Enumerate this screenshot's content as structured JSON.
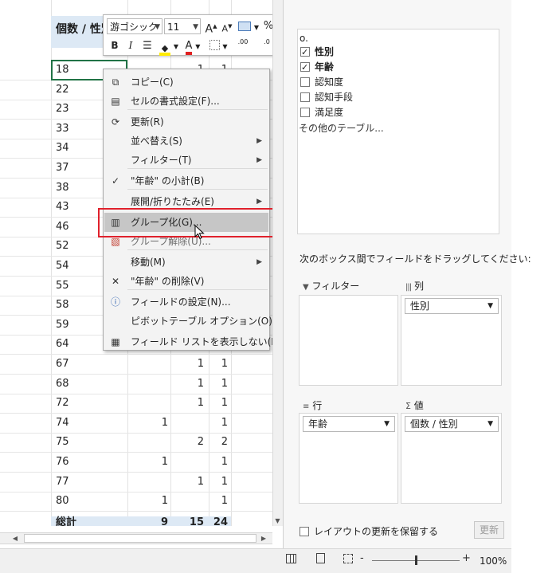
{
  "sheet": {
    "header_label": "個数 / 性別",
    "rows": [
      {
        "age": "18",
        "a": "",
        "b": "1",
        "t": "1"
      },
      {
        "age": "22",
        "a": "",
        "b": "",
        "t": ""
      },
      {
        "age": "23",
        "a": "",
        "b": "",
        "t": ""
      },
      {
        "age": "33",
        "a": "",
        "b": "",
        "t": ""
      },
      {
        "age": "34",
        "a": "",
        "b": "",
        "t": ""
      },
      {
        "age": "37",
        "a": "",
        "b": "",
        "t": ""
      },
      {
        "age": "38",
        "a": "",
        "b": "",
        "t": ""
      },
      {
        "age": "43",
        "a": "",
        "b": "",
        "t": ""
      },
      {
        "age": "46",
        "a": "",
        "b": "",
        "t": ""
      },
      {
        "age": "52",
        "a": "",
        "b": "",
        "t": ""
      },
      {
        "age": "54",
        "a": "",
        "b": "",
        "t": ""
      },
      {
        "age": "55",
        "a": "",
        "b": "",
        "t": ""
      },
      {
        "age": "58",
        "a": "",
        "b": "",
        "t": ""
      },
      {
        "age": "59",
        "a": "",
        "b": "",
        "t": ""
      },
      {
        "age": "64",
        "a": "",
        "b": "",
        "t": ""
      },
      {
        "age": "67",
        "a": "",
        "b": "1",
        "t": "1"
      },
      {
        "age": "68",
        "a": "",
        "b": "1",
        "t": "1"
      },
      {
        "age": "72",
        "a": "",
        "b": "1",
        "t": "1"
      },
      {
        "age": "74",
        "a": "1",
        "b": "",
        "t": "1"
      },
      {
        "age": "75",
        "a": "",
        "b": "2",
        "t": "2"
      },
      {
        "age": "76",
        "a": "1",
        "b": "",
        "t": "1"
      },
      {
        "age": "77",
        "a": "",
        "b": "1",
        "t": "1"
      },
      {
        "age": "80",
        "a": "1",
        "b": "",
        "t": "1"
      }
    ],
    "total": {
      "label": "総計",
      "a": "9",
      "b": "15",
      "t": "24"
    }
  },
  "toolbar": {
    "font_name": "游ゴシック",
    "font_size": "11",
    "increase_font": "A",
    "decrease_font": "A",
    "percent": "%",
    "comma": ",",
    "bold": "B",
    "italic": "I",
    "font_color_letter": "A",
    "decimal_increase": ".00",
    "decimal_decrease": ".0"
  },
  "context_menu": {
    "items": [
      {
        "label": "コピー(C)",
        "icon": "copy-icon"
      },
      {
        "label": "セルの書式設定(F)...",
        "icon": "format-cells-icon"
      },
      {
        "label": "更新(R)",
        "icon": "refresh-icon"
      },
      {
        "label": "並べ替え(S)",
        "icon": ""
      },
      {
        "label": "フィルター(T)",
        "icon": ""
      },
      {
        "label": "\"年齢\" の小計(B)",
        "icon": "check-icon"
      },
      {
        "label": "展開/折りたたみ(E)",
        "icon": ""
      },
      {
        "label": "グループ化(G)...",
        "icon": "group-icon"
      },
      {
        "label": "グループ解除(U)...",
        "icon": "ungroup-icon"
      },
      {
        "label": "移動(M)",
        "icon": ""
      },
      {
        "label": "\"年齢\" の削除(V)",
        "icon": "delete-x-icon"
      },
      {
        "label": "フィールドの設定(N)...",
        "icon": "field-settings-icon"
      },
      {
        "label": "ピボットテーブル オプション(O)...",
        "icon": ""
      },
      {
        "label": "フィールド リストを表示しない(D)",
        "icon": "field-list-icon"
      }
    ]
  },
  "field_list": {
    "top_partial": "o.",
    "fields": [
      {
        "label": "性別",
        "checked": true
      },
      {
        "label": "年齢",
        "checked": true
      },
      {
        "label": "認知度",
        "checked": false
      },
      {
        "label": "認知手段",
        "checked": false
      },
      {
        "label": "満足度",
        "checked": false
      }
    ],
    "more_tables": "その他のテーブル...",
    "drag_hint": "次のボックス間でフィールドをドラッグしてください:",
    "areas": {
      "filter": {
        "title": "フィルター",
        "icon": "filter-icon",
        "item": ""
      },
      "columns": {
        "title": "列",
        "icon": "columns-icon",
        "item": "性別"
      },
      "rows": {
        "title": "行",
        "icon": "rows-icon",
        "item": "年齢"
      },
      "values": {
        "title": "値",
        "icon": "sigma-icon",
        "item": "個数 / 性別"
      }
    },
    "defer_label": "レイアウトの更新を保留する",
    "update_button": "更新"
  },
  "status": {
    "zoom_minus": "-",
    "zoom_plus": "+",
    "zoom_level": "100%"
  },
  "colors": {
    "header_band": "#dde9f5",
    "highlight_box": "#e0212c",
    "active_cell": "#217346"
  }
}
